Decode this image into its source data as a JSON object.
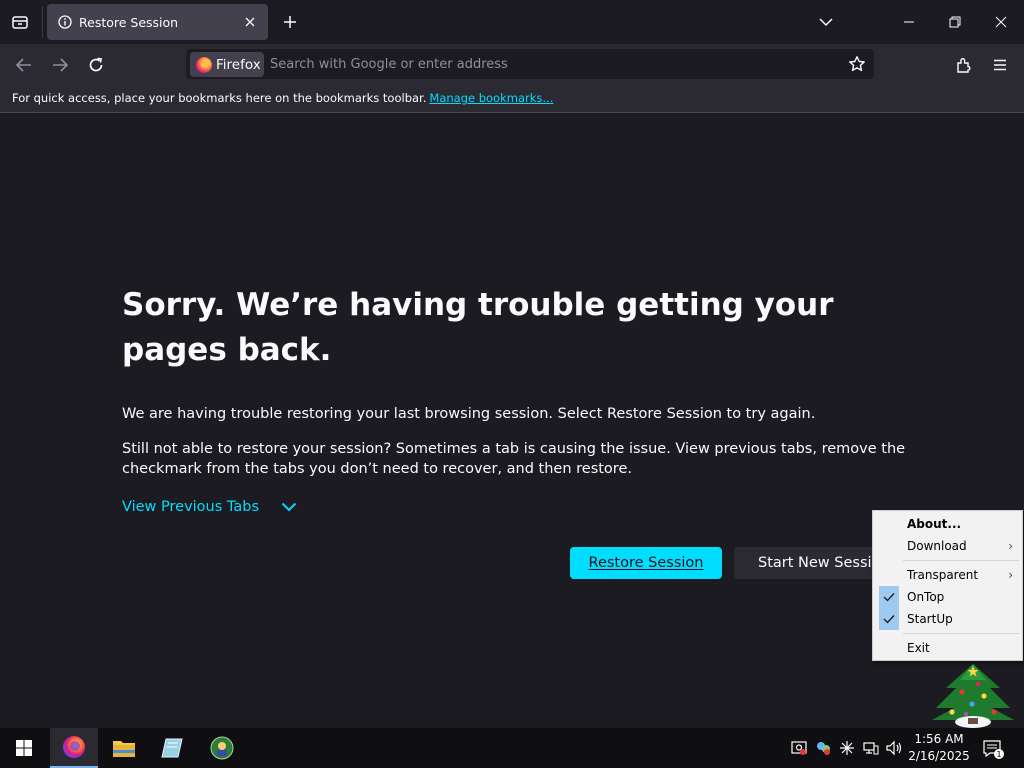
{
  "tabbar": {
    "tab_title": "Restore Session"
  },
  "navbar": {
    "identity_label": "Firefox",
    "url_placeholder": "Search with Google or enter address"
  },
  "bookmarks_bar": {
    "message": "For quick access, place your bookmarks here on the bookmarks toolbar.",
    "manage_link": "Manage bookmarks..."
  },
  "page": {
    "heading": "Sorry. We’re having trouble getting your pages back.",
    "paragraph1": "We are having trouble restoring your last browsing session. Select Restore Session to try again.",
    "paragraph2": "Still not able to restore your session? Sometimes a tab is causing the issue. View previous tabs, remove the checkmark from the tabs you don’t need to recover, and then restore.",
    "view_previous_tabs": "View Previous Tabs",
    "restore_button": "Restore Session",
    "new_session_button": "Start New Session"
  },
  "context_menu": {
    "items": [
      {
        "label": "About...",
        "bold": true
      },
      {
        "label": "Download",
        "submenu": true
      },
      {
        "label": "Transparent",
        "submenu": true
      },
      {
        "label": "OnTop",
        "checked": true
      },
      {
        "label": "StartUp",
        "checked": true
      },
      {
        "label": "Exit"
      }
    ]
  },
  "taskbar": {
    "time": "1:56 AM",
    "date": "2/16/2025",
    "notification_count": "1"
  },
  "colors": {
    "accent": "#00ddff",
    "page_bg": "#1c1b22",
    "toolbar_bg": "#2b2a33"
  }
}
